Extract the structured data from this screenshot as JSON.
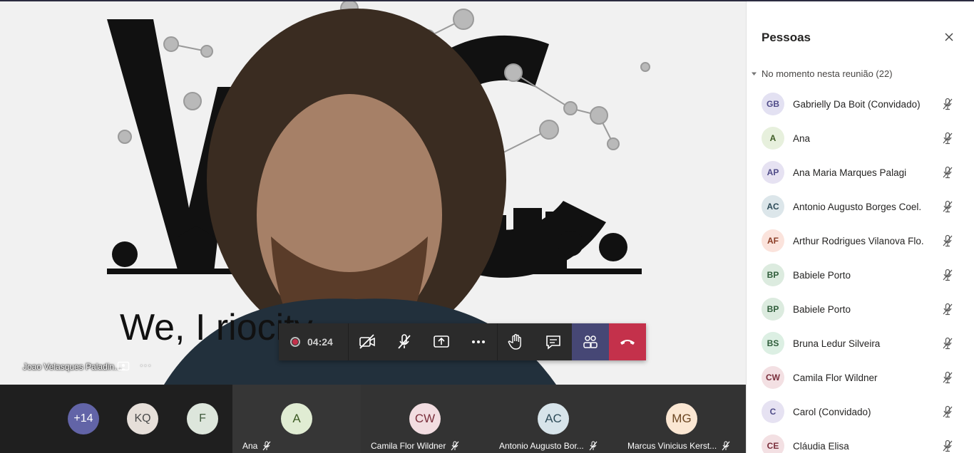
{
  "stage": {
    "speaker_name": "Joao Velasques Paladin...",
    "speaker_more": "···",
    "slide_tagline": "We, I                        riocity"
  },
  "controls": {
    "recording_time": "04:24",
    "buttons": [
      "camera-off",
      "mic-off",
      "share",
      "more",
      "raise-hand",
      "chat",
      "participants",
      "hang-up"
    ]
  },
  "strip": {
    "minis": [
      {
        "initials": "+14",
        "bg": "#6264a7",
        "fg": "#ffffff"
      },
      {
        "initials": "KQ",
        "bg": "#e6dfd9",
        "fg": "#4a4a4a"
      },
      {
        "initials": "F",
        "bg": "#dde6dc",
        "fg": "#3f5a3c"
      }
    ],
    "tiles": [
      {
        "initials": "A",
        "name": "Ana",
        "bg": "#e0ecd3",
        "fg": "#3d5b24"
      },
      {
        "initials": "CW",
        "name": "Camila Flor Wildner",
        "bg": "#f2dde1",
        "fg": "#7a2f3c"
      },
      {
        "initials": "AC",
        "name": "Antonio Augusto Bor...",
        "bg": "#d7e4ea",
        "fg": "#2d4b58"
      },
      {
        "initials": "MG",
        "name": "Marcus Vinicius Kerst...",
        "bg": "#fbe7d3",
        "fg": "#6b4622"
      }
    ]
  },
  "panel": {
    "title": "Pessoas",
    "section_label": "No momento nesta reunião (22)",
    "people": [
      {
        "initials": "GB",
        "name": "Gabrielly Da Boit (Convidado)",
        "bg": "#e3e1f2",
        "fg": "#4f4b88"
      },
      {
        "initials": "A",
        "name": "Ana",
        "bg": "#e7f0dd",
        "fg": "#3d5b24"
      },
      {
        "initials": "AP",
        "name": "Ana Maria Marques Palagi",
        "bg": "#e6e2f2",
        "fg": "#4f4b88"
      },
      {
        "initials": "AC",
        "name": "Antonio Augusto Borges Coel.",
        "bg": "#dce6ea",
        "fg": "#2d4b58"
      },
      {
        "initials": "AF",
        "name": "Arthur Rodrigues Vilanova Flo.",
        "bg": "#fbe3dc",
        "fg": "#8a3b24"
      },
      {
        "initials": "BP",
        "name": "Babiele Porto",
        "bg": "#dcebdf",
        "fg": "#2f5c3a"
      },
      {
        "initials": "BP",
        "name": "Babiele Porto",
        "bg": "#dcebdf",
        "fg": "#2f5c3a"
      },
      {
        "initials": "BS",
        "name": "Bruna Ledur Silveira",
        "bg": "#dcefe3",
        "fg": "#2f5c3a"
      },
      {
        "initials": "CW",
        "name": "Camila Flor Wildner",
        "bg": "#f3e0e3",
        "fg": "#7a2f3c"
      },
      {
        "initials": "C",
        "name": "Carol (Convidado)",
        "bg": "#e6e2f2",
        "fg": "#4f4b88"
      },
      {
        "initials": "CE",
        "name": "Cláudia Elisa",
        "bg": "#f3e0e3",
        "fg": "#7a2f3c"
      }
    ]
  }
}
